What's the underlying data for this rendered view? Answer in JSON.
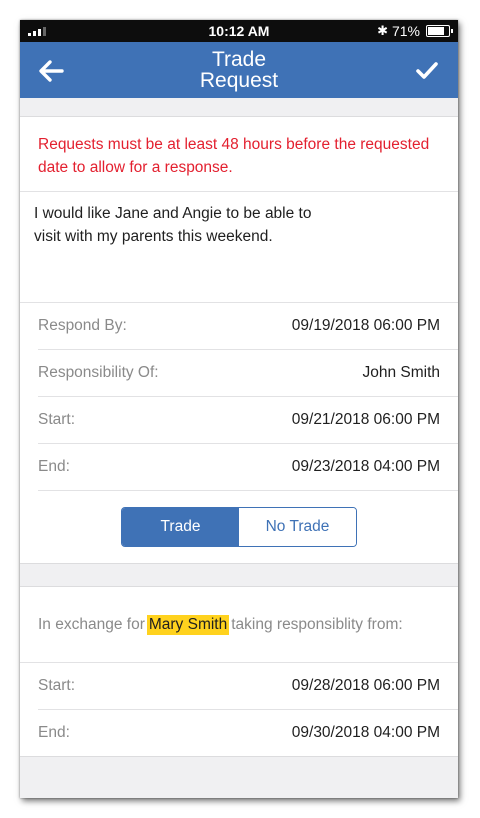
{
  "status_bar": {
    "time": "10:12 AM",
    "battery_percent": "71%",
    "battery_level": 0.71,
    "icons": [
      "signal-icon",
      "bluetooth-icon",
      "battery-icon"
    ]
  },
  "nav": {
    "title_line1": "Trade",
    "title_line2": "Request",
    "back_icon": "back-arrow-icon",
    "confirm_icon": "checkmark-icon"
  },
  "request": {
    "warning": "Requests must be at least 48 hours before the requested date to allow for a response.",
    "message_line1": "I would like Jane and Angie to be able to",
    "message_line2": "visit with my parents this weekend.",
    "details": [
      {
        "label": "Respond By:",
        "value": "09/19/2018 06:00 PM"
      },
      {
        "label": "Responsibility Of:",
        "value": "John Smith"
      },
      {
        "label": "Start:",
        "value": "09/21/2018 06:00 PM"
      },
      {
        "label": "End:",
        "value": "09/23/2018 04:00 PM"
      }
    ],
    "toggle": {
      "trade_label": "Trade",
      "no_trade_label": "No Trade",
      "selected": "Trade"
    }
  },
  "exchange": {
    "prefix": "In exchange for",
    "person": "Mary Smith",
    "suffix": "taking responsiblity from:",
    "details": [
      {
        "label": "Start:",
        "value": "09/28/2018 06:00 PM"
      },
      {
        "label": "End:",
        "value": "09/30/2018 04:00 PM"
      }
    ]
  },
  "colors": {
    "primary": "#3f72b6",
    "warning": "#e3202f",
    "highlight": "#ffd21e"
  }
}
